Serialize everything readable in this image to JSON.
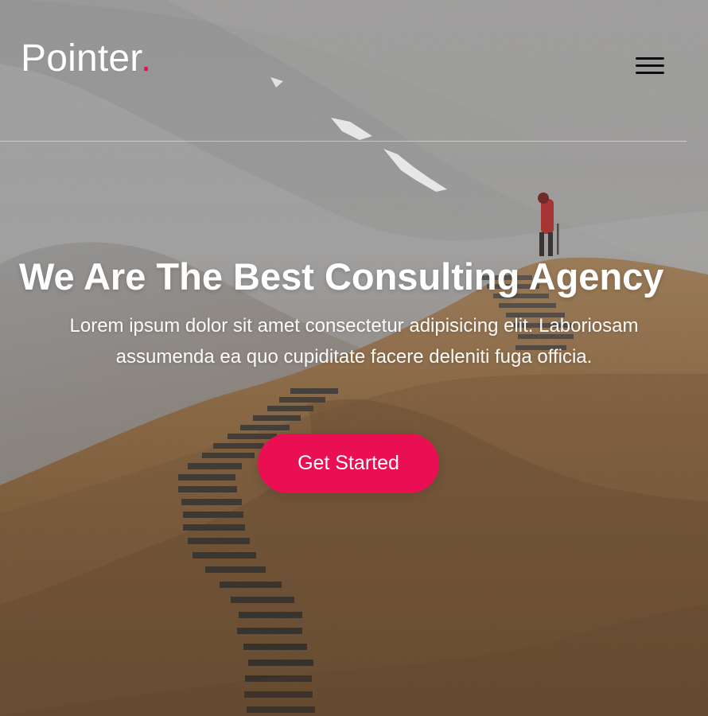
{
  "brand": {
    "name": "Pointer",
    "dot": "."
  },
  "hero": {
    "title": "We Are The Best Consulting Agency",
    "subtitle": "Lorem ipsum dolor sit amet consectetur adipisicing elit. Laboriosam assumenda ea quo cupiditate facere deleniti fuga officia.",
    "cta_label": "Get Started"
  },
  "icons": {
    "menu": "hamburger-menu-icon"
  },
  "colors": {
    "accent": "#ea0f53",
    "logo_dot": "#e8124f",
    "text": "#ffffff",
    "menu_icon": "#0f0f0f"
  }
}
